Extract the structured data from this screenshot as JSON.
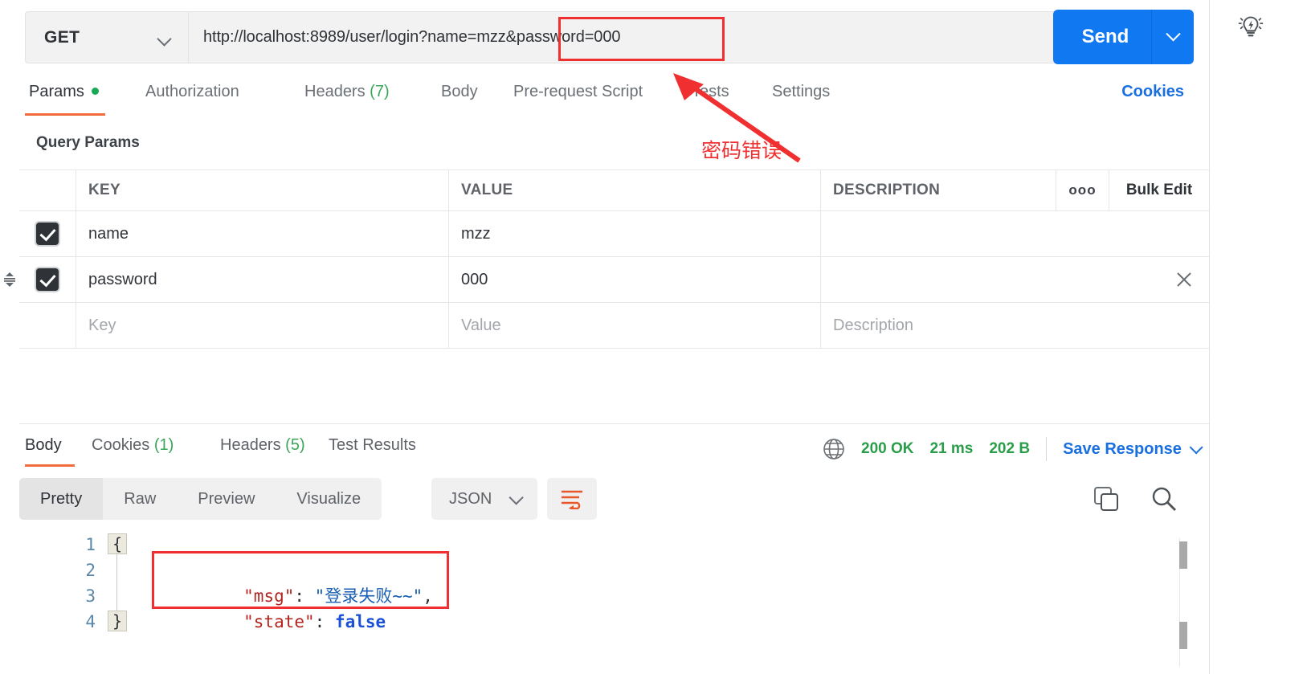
{
  "request": {
    "method": "GET",
    "url": "http://localhost:8989/user/login?name=mzz&password=000",
    "send_label": "Send",
    "tabs": [
      {
        "label": "Params",
        "badge": "",
        "has_dot": true,
        "active": true
      },
      {
        "label": "Authorization",
        "badge": "",
        "has_dot": false,
        "active": false
      },
      {
        "label": "Headers",
        "badge": "(7)",
        "has_dot": false,
        "active": false
      },
      {
        "label": "Body",
        "badge": "",
        "has_dot": false,
        "active": false
      },
      {
        "label": "Pre-request Script",
        "badge": "",
        "has_dot": false,
        "active": false
      },
      {
        "label": "Tests",
        "badge": "",
        "has_dot": false,
        "active": false
      },
      {
        "label": "Settings",
        "badge": "",
        "has_dot": false,
        "active": false
      }
    ],
    "cookies_link": "Cookies"
  },
  "annotation": {
    "text": "密码错误",
    "color": "#f03030"
  },
  "params": {
    "section_title": "Query Params",
    "columns": [
      "KEY",
      "VALUE",
      "DESCRIPTION"
    ],
    "menu_dots": "ooo",
    "bulk_edit": "Bulk Edit",
    "rows": [
      {
        "checked": true,
        "key": "name",
        "value": "mzz",
        "description": ""
      },
      {
        "checked": true,
        "key": "password",
        "value": "000",
        "description": ""
      }
    ],
    "placeholder_row": {
      "key": "Key",
      "value": "Value",
      "description": "Description"
    }
  },
  "response": {
    "tabs": [
      {
        "label": "Body",
        "badge": "",
        "active": true
      },
      {
        "label": "Cookies",
        "badge": "(1)",
        "active": false
      },
      {
        "label": "Headers",
        "badge": "(5)",
        "active": false
      },
      {
        "label": "Test Results",
        "badge": "",
        "active": false
      }
    ],
    "status_code": "200 OK",
    "time": "21 ms",
    "size": "202 B",
    "save_response": "Save Response",
    "format_tabs": [
      {
        "label": "Pretty",
        "active": true
      },
      {
        "label": "Raw",
        "active": false
      },
      {
        "label": "Preview",
        "active": false
      },
      {
        "label": "Visualize",
        "active": false
      }
    ],
    "content_type": "JSON",
    "body_lines": [
      {
        "num": "1",
        "text": "{",
        "fold": true
      },
      {
        "num": "2",
        "text": "    \"msg\": \"登录失败~~\",",
        "fold": false
      },
      {
        "num": "3",
        "text": "    \"state\": false",
        "fold": false
      },
      {
        "num": "4",
        "text": "}",
        "fold": true
      }
    ],
    "body_tokens": {
      "line2_key": "\"msg\"",
      "line2_colon": ": ",
      "line2_value": "\"登录失败~~\"",
      "line2_comma": ",",
      "line3_key": "\"state\"",
      "line3_colon": ": ",
      "line3_value": "false",
      "open_brace": "{",
      "close_brace": "}"
    }
  },
  "colors": {
    "accent_orange": "#f26b3a",
    "send_blue": "#1079f2",
    "link_blue": "#1a6fe0",
    "status_green": "#2a9d4a",
    "annot_red": "#f03030"
  }
}
